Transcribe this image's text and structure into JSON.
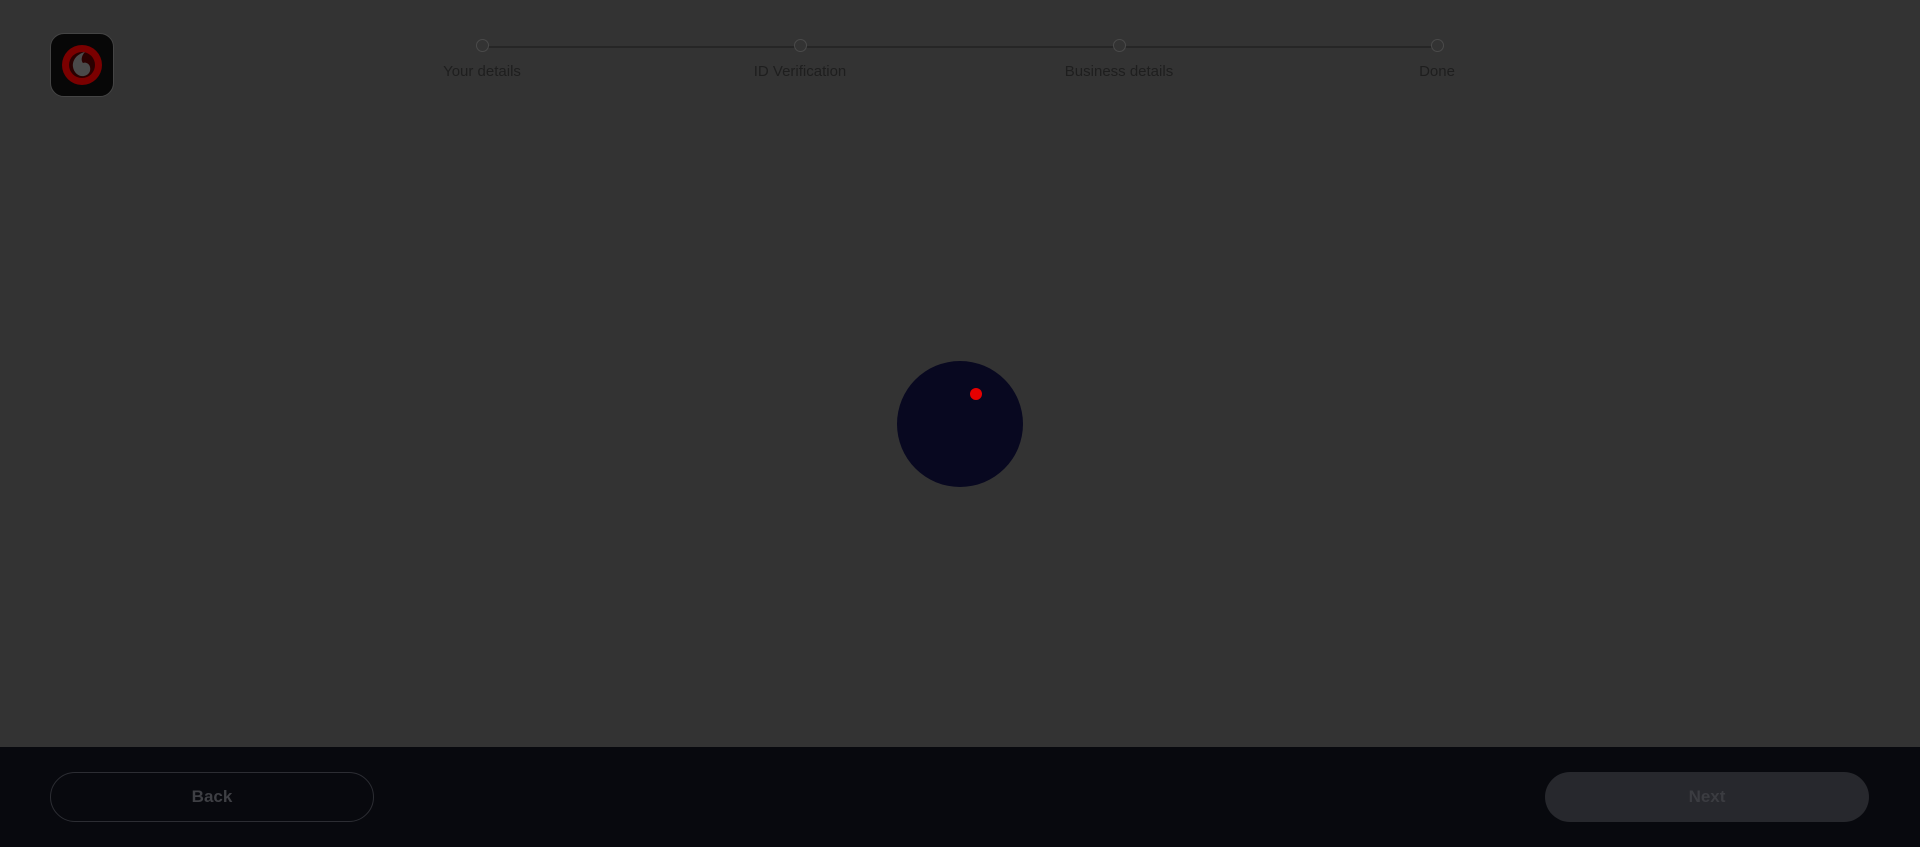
{
  "brand": {
    "logo_icon": "vodafone-speechmark-icon",
    "logo_color": "#e60000"
  },
  "stepper": {
    "steps": [
      {
        "label": "Your details"
      },
      {
        "label": "ID Verification"
      },
      {
        "label": "Business details"
      },
      {
        "label": "Done"
      }
    ]
  },
  "loader": {
    "icon": "loading-spinner-icon",
    "accent": "#e60000"
  },
  "footer": {
    "back_label": "Back",
    "next_label": "Next"
  }
}
